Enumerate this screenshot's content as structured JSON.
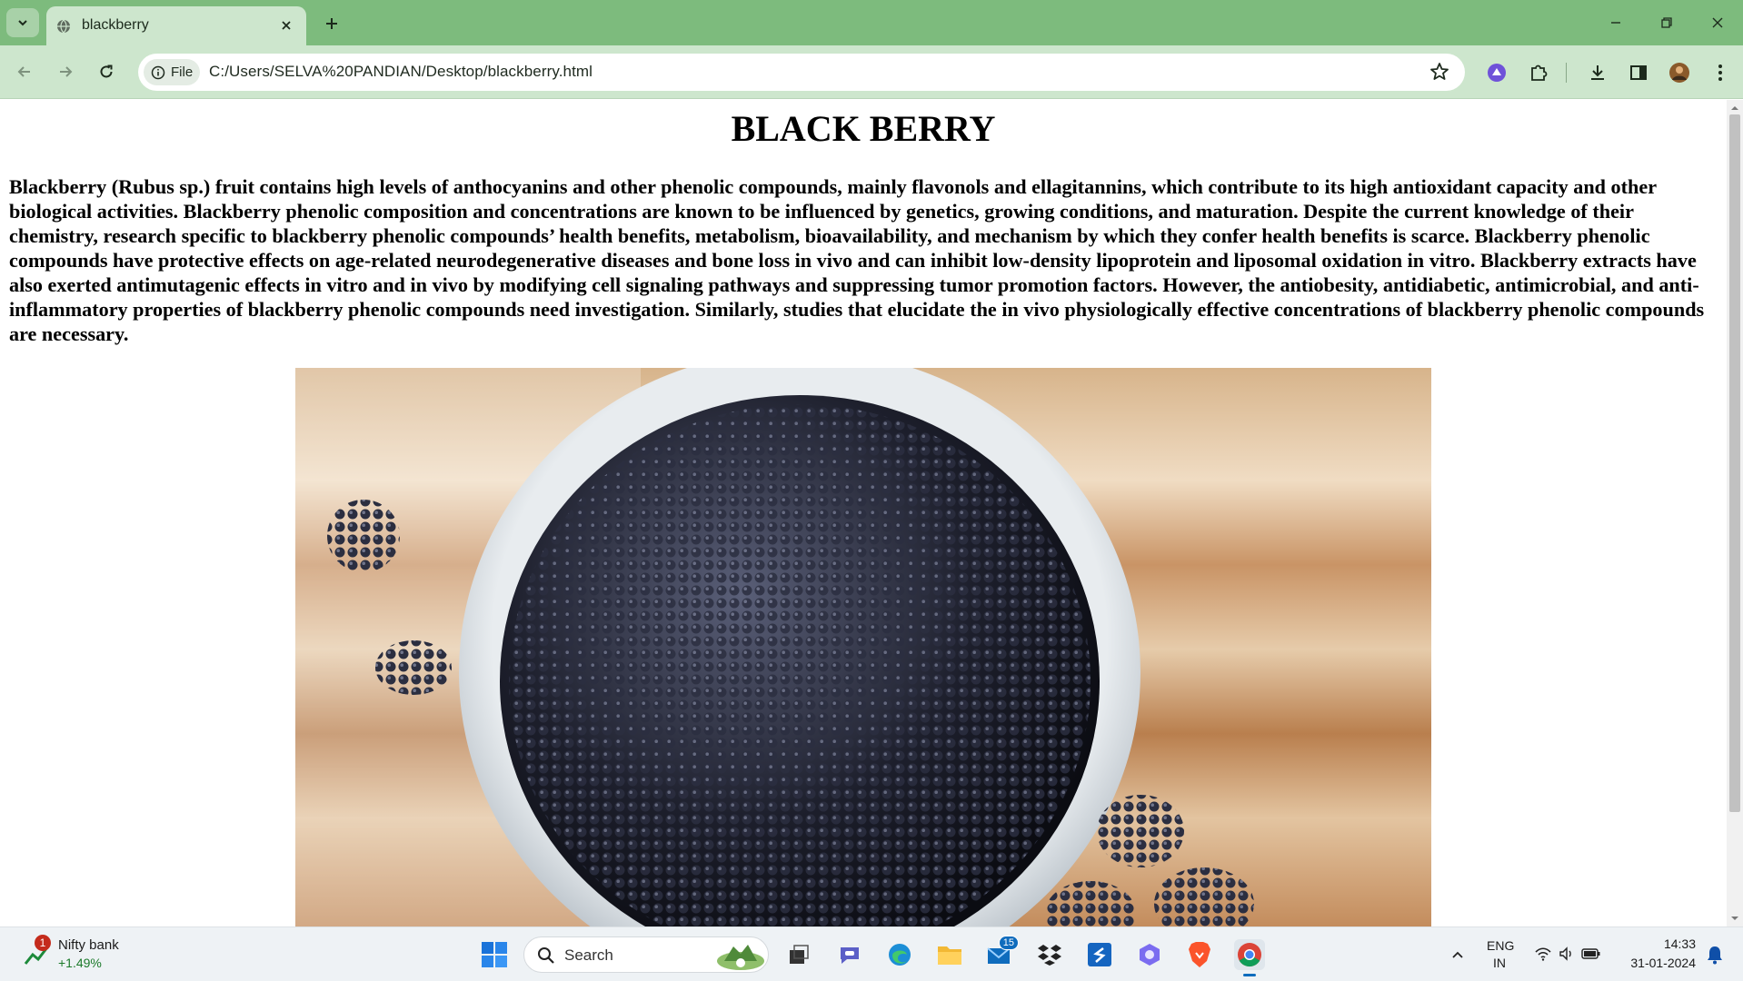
{
  "browser": {
    "tab_title": "blackberry",
    "file_chip_label": "File",
    "url": "C:/Users/SELVA%20PANDIAN/Desktop/blackberry.html",
    "colors": {
      "frame": "#7dbb7d",
      "toolbar": "#cde6cd"
    }
  },
  "page": {
    "heading": "BLACK BERRY",
    "paragraph": "Blackberry (Rubus sp.) fruit contains high levels of anthocyanins and other phenolic compounds, mainly flavonols and ellagitannins, which contribute to its high antioxidant capacity and other biological activities. Blackberry phenolic composition and concentrations are known to be influenced by genetics, growing conditions, and maturation. Despite the current knowledge of their chemistry, research specific to blackberry phenolic compounds’ health benefits, metabolism, bioavailability, and mechanism by which they confer health benefits is scarce. Blackberry phenolic compounds have protective effects on age-related neurodegenerative diseases and bone loss in vivo and can inhibit low-density lipoprotein and liposomal oxidation in vitro. Blackberry extracts have also exerted antimutagenic effects in vitro and in vivo by modifying cell signaling pathways and suppressing tumor promotion factors. However, the antiobesity, antidiabetic, antimicrobial, and anti-inflammatory properties of blackberry phenolic compounds need investigation. Similarly, studies that elucidate the in vivo physiologically effective concentrations of blackberry phenolic compounds are necessary.",
    "image_icon": "blackberry-bowl-photo"
  },
  "taskbar": {
    "widget_title": "Nifty bank",
    "widget_value": "+1.49%",
    "widget_badge": "1",
    "search_label": "Search",
    "mail_badge": "15",
    "lang_primary": "ENG",
    "lang_secondary": "IN",
    "time": "14:33",
    "date": "31-01-2024"
  }
}
